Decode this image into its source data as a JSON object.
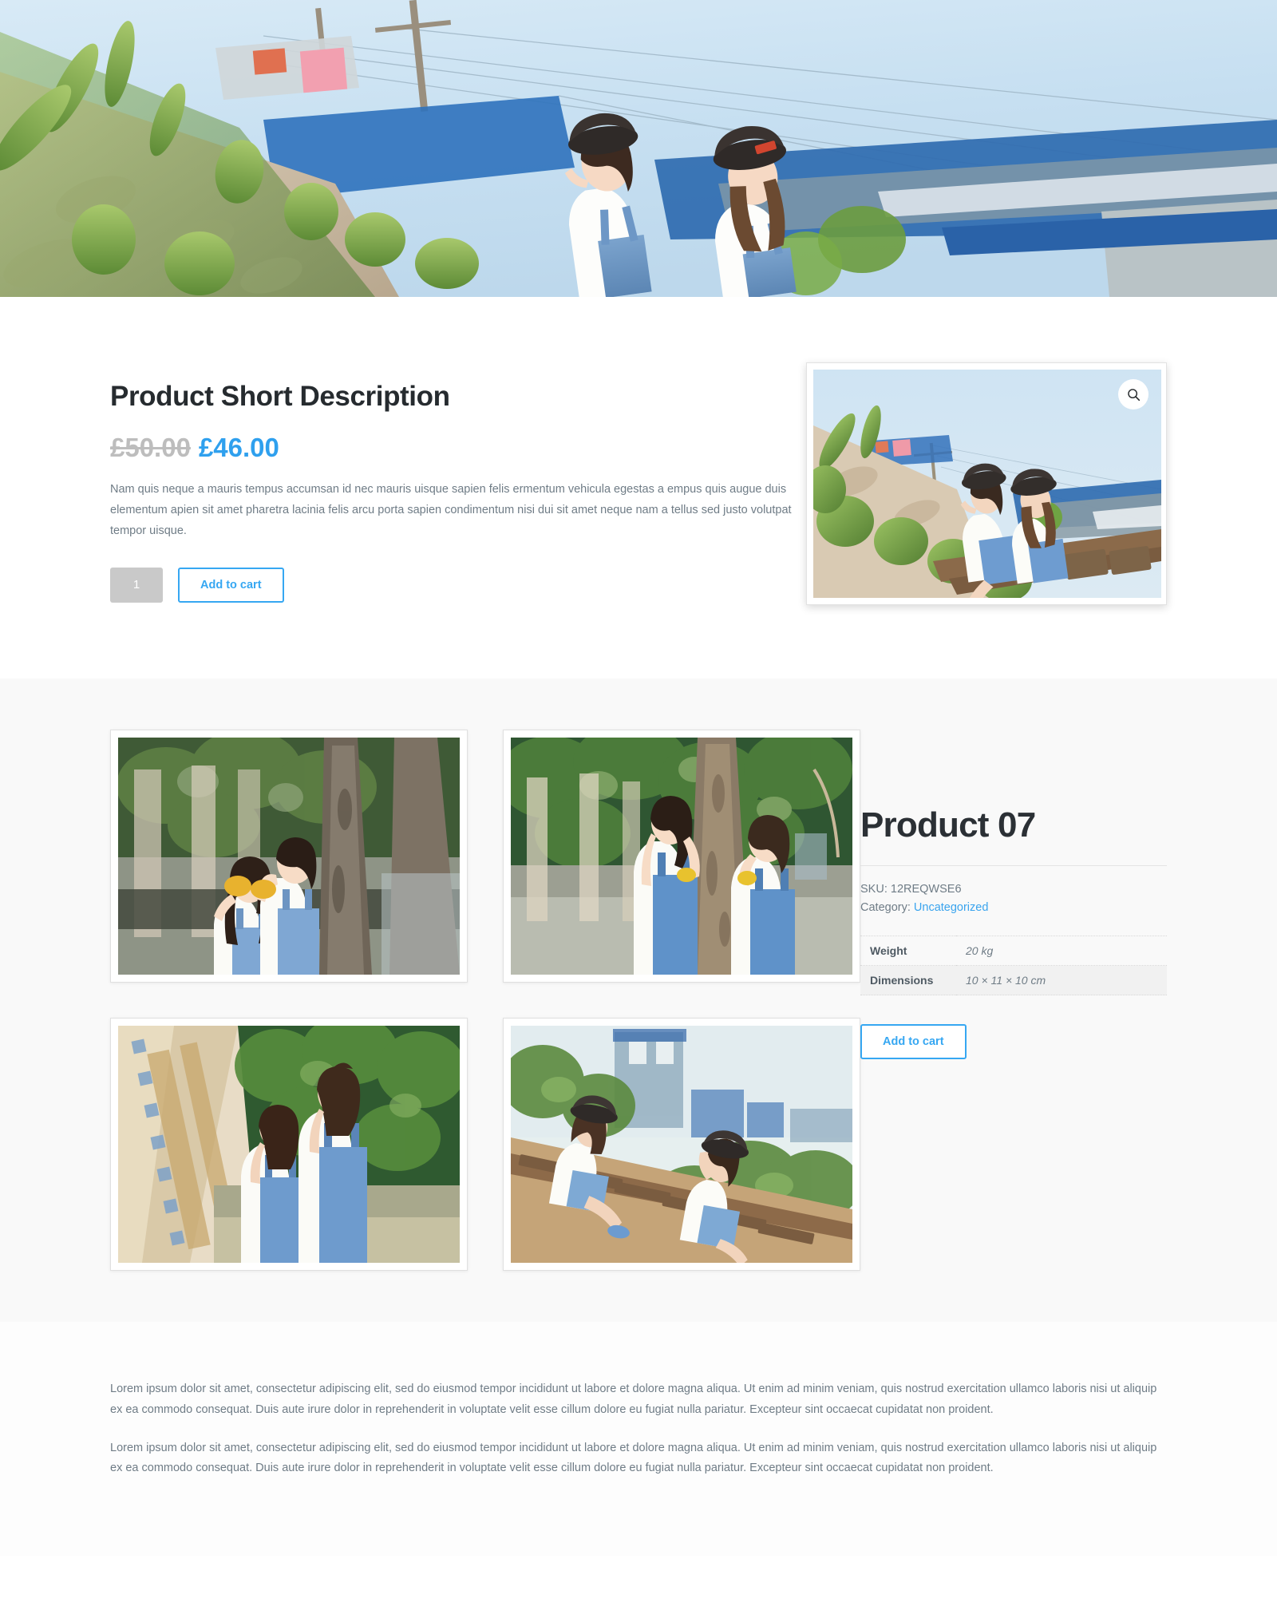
{
  "hero": {
    "alt": "Two girls in bucket hats and denim overalls standing by a sunlit railway embankment with green plants and blue corrugated buildings under a clear sky"
  },
  "summary": {
    "heading": "Product Short Description",
    "price_old": "£50.00",
    "price_new": "£46.00",
    "description": "Nam quis neque a mauris tempus accumsan id nec mauris uisque sapien felis ermentum vehicula egestas a empus quis augue duis elementum apien sit amet pharetra lacinia felis arcu porta sapien condimentum nisi dui sit amet neque nam a tellus sed justo volutpat tempor uisque.",
    "quantity_value": "1",
    "quantity_placeholder": "1",
    "add_to_cart_label": "Add to cart",
    "zoom_icon": "search-icon",
    "main_image_alt": "Two girls in bucket hats and denim dresses sitting on rusty railway tracks beside green vegetation"
  },
  "gallery": {
    "items": [
      {
        "alt": "Two girls under a large tree, one holding a yellow leaf over the other's eyes"
      },
      {
        "alt": "Two girls in denim overalls standing on either side of a tree trunk on a sunlit street"
      },
      {
        "alt": "Two girls in denim walking beside a colourful tiled wall with green foliage"
      },
      {
        "alt": "Two girls in denim overalls sitting on railway tracks facing each other"
      }
    ]
  },
  "details": {
    "title": "Product 07",
    "sku_label": "SKU:",
    "sku_value": "12REQWSE6",
    "category_label": "Category:",
    "category_value": "Uncategorized",
    "attributes": [
      {
        "name": "Weight",
        "value": "20 kg"
      },
      {
        "name": "Dimensions",
        "value": "10 × 11 × 10 cm"
      }
    ],
    "add_to_cart_label": "Add to cart"
  },
  "footer": {
    "paragraphs": [
      "Lorem ipsum dolor sit amet, consectetur adipiscing elit, sed do eiusmod tempor incididunt ut labore et dolore magna aliqua. Ut enim ad minim veniam, quis nostrud exercitation ullamco laboris nisi ut aliquip ex ea commodo consequat. Duis aute irure dolor in reprehenderit in voluptate velit esse cillum dolore eu fugiat nulla pariatur. Excepteur sint occaecat cupidatat non proident.",
      "Lorem ipsum dolor sit amet, consectetur adipiscing elit, sed do eiusmod tempor incididunt ut labore et dolore magna aliqua. Ut enim ad minim veniam, quis nostrud exercitation ullamco laboris nisi ut aliquip ex ea commodo consequat. Duis aute irure dolor in reprehenderit in voluptate velit esse cillum dolore eu fugiat nulla pariatur. Excepteur sint occaecat cupidatat non proident."
    ]
  },
  "colors": {
    "accent": "#36a7f2",
    "price_new": "#2fa0ee",
    "price_old": "#bdbdbd",
    "heading": "#262b2f",
    "body_text": "#6f7c86",
    "gallery_bg": "#f9f9f9"
  }
}
